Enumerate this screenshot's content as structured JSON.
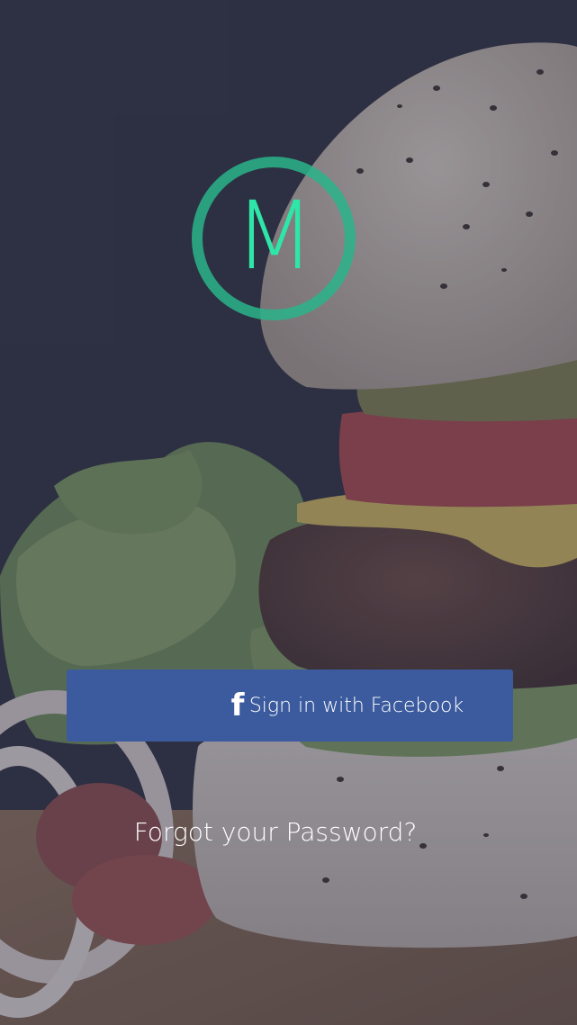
{
  "logo": {
    "letter": "M",
    "accent_color": "#2ee6a8"
  },
  "background": {
    "image_subject": "burger-photo",
    "overlay_color": "#303248"
  },
  "facebook_button": {
    "icon": "facebook-f-icon",
    "icon_glyph": "f",
    "label": "Sign in with Facebook",
    "color": "#3b5b9e"
  },
  "forgot_password": {
    "label": "Forgot your Password?"
  }
}
